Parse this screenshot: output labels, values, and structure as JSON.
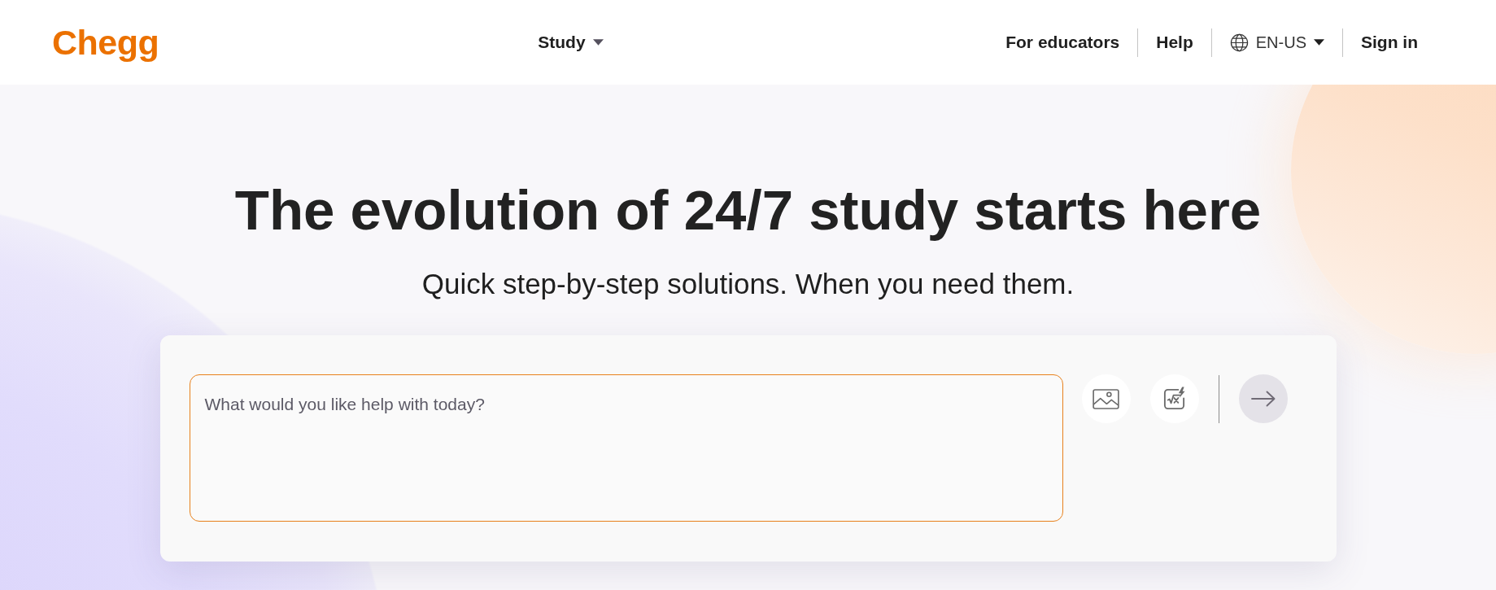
{
  "header": {
    "logo": "Chegg",
    "nav": [
      {
        "label": "Study",
        "kind": "dropdown"
      }
    ],
    "links": [
      {
        "label": "For educators",
        "kind": "link"
      },
      {
        "label": "Help",
        "kind": "link"
      },
      {
        "label": "EN-US",
        "kind": "language"
      },
      {
        "label": "Sign in",
        "kind": "link"
      }
    ]
  },
  "hero": {
    "title": "The evolution of 24/7 study starts here",
    "subtitle": "Quick step-by-step solutions. When you need them."
  },
  "search": {
    "placeholder": "What would you like help with today?",
    "submit": {
      "disabled": true
    }
  }
}
